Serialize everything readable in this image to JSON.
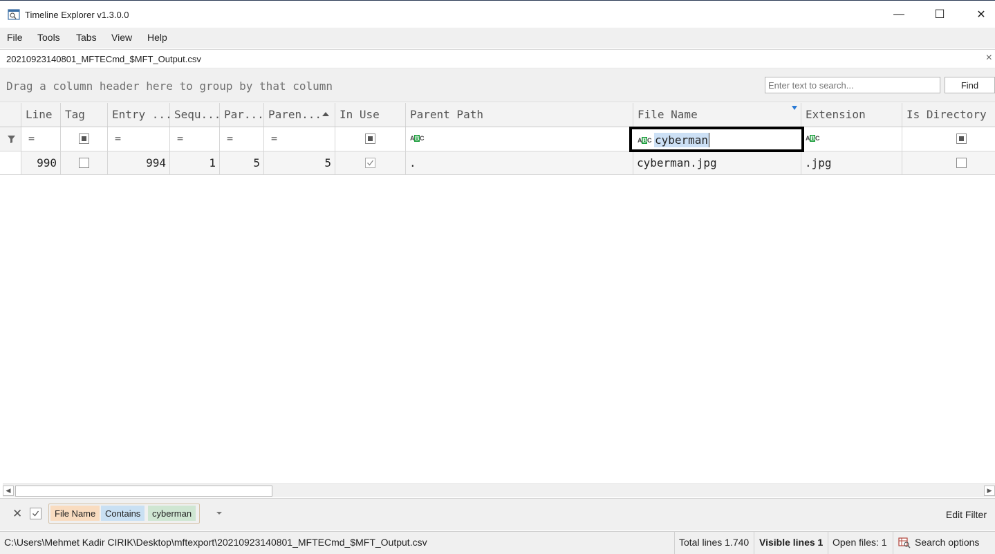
{
  "window": {
    "title": "Timeline Explorer v1.3.0.0",
    "minimize_glyph": "—",
    "maximize_glyph": "☐",
    "close_glyph": "✕"
  },
  "menu": [
    "File",
    "Tools",
    "Tabs",
    "View",
    "Help"
  ],
  "tab": {
    "label": "20210923140801_MFTECmd_$MFT_Output.csv",
    "close_glyph": "×"
  },
  "group_panel": {
    "hint": "Drag a column header here to group by that column"
  },
  "search": {
    "placeholder": "Enter text to search...",
    "find_label": "Find"
  },
  "columns": [
    "Line",
    "Tag",
    "Entry ...",
    "Sequ...",
    "Par...",
    "Paren...",
    "In Use",
    "Parent Path",
    "File Name",
    "Extension",
    "Is Directory"
  ],
  "filter_row": {
    "equals_glyph": "=",
    "file_name_value": "cyberman",
    "abc_a": "A",
    "abc_b": "B",
    "abc_c": "C"
  },
  "rows": [
    {
      "line": "990",
      "tag": false,
      "entry": "994",
      "sequence": "1",
      "parent_entry": "5",
      "parent_sequence": "5",
      "in_use": true,
      "parent_path": ".",
      "file_name": "cyberman.jpg",
      "extension": ".jpg",
      "is_directory": false
    }
  ],
  "active_filter": {
    "field": "File Name",
    "operator": "Contains",
    "value": "cyberman",
    "clear_glyph": "✕",
    "edit_label": "Edit Filter"
  },
  "status": {
    "path": "C:\\Users\\Mehmet Kadir CIRIK\\Desktop\\mftexport\\20210923140801_MFTECmd_$MFT_Output.csv",
    "total_lines": "Total lines 1.740",
    "visible_lines": "Visible lines 1",
    "open_files": "Open files: 1",
    "search_options": "Search options"
  },
  "colors": {
    "filter_field_bg": "#f9dcc0",
    "filter_op_bg": "#c9e0f3",
    "filter_val_bg": "#cfe6d2",
    "selection": "#cce0f5",
    "title_border": "#2b3a55"
  }
}
